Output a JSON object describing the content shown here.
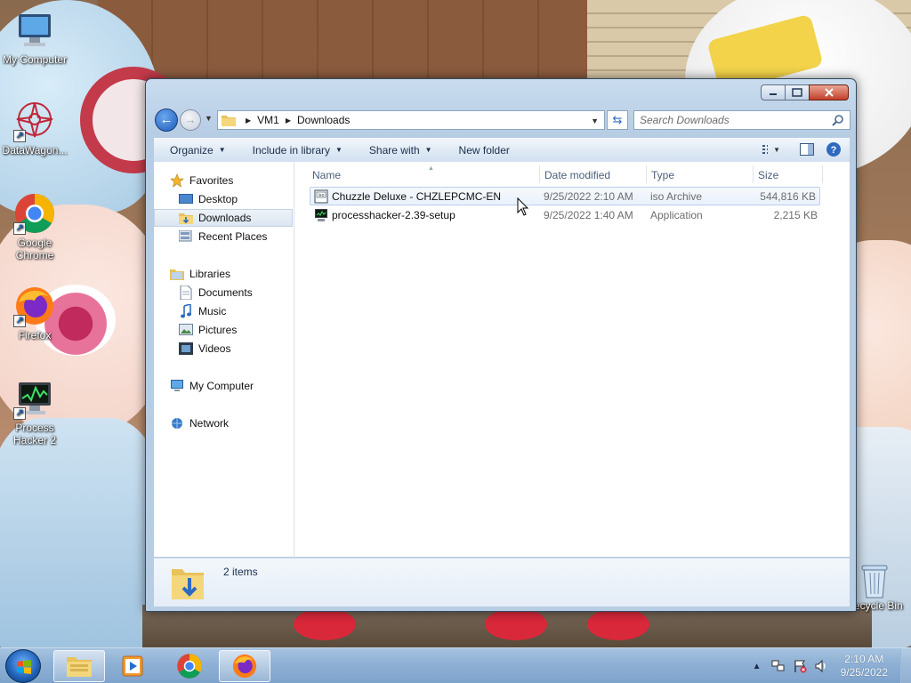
{
  "desktop": {
    "icons": [
      {
        "label": "My Computer",
        "icon": "computer-icon"
      },
      {
        "label": "DataWagon...",
        "icon": "datawagon-icon"
      },
      {
        "label": "Google Chrome",
        "icon": "chrome-icon"
      },
      {
        "label": "Firefox",
        "icon": "firefox-icon"
      },
      {
        "label": "Process Hacker 2",
        "icon": "process-hacker-icon"
      }
    ],
    "recycle_bin": "Recycle Bin"
  },
  "window": {
    "breadcrumb": [
      "VM1",
      "Downloads"
    ],
    "search_placeholder": "Search Downloads",
    "toolbar": {
      "organize": "Organize",
      "include_in_library": "Include in library",
      "share_with": "Share with",
      "new_folder": "New folder"
    },
    "nav": {
      "favorites": "Favorites",
      "desktop": "Desktop",
      "downloads": "Downloads",
      "recent_places": "Recent Places",
      "libraries": "Libraries",
      "documents": "Documents",
      "music": "Music",
      "pictures": "Pictures",
      "videos": "Videos",
      "my_computer": "My Computer",
      "network": "Network"
    },
    "columns": {
      "name": "Name",
      "date": "Date modified",
      "type": "Type",
      "size": "Size"
    },
    "files": [
      {
        "name": "Chuzzle Deluxe - CHZLEPCMC-EN",
        "date": "9/25/2022 2:10 AM",
        "type": "iso Archive",
        "size": "544,816 KB",
        "icon": "iso-icon"
      },
      {
        "name": "processhacker-2.39-setup",
        "date": "9/25/2022 1:40 AM",
        "type": "Application",
        "size": "2,215 KB",
        "icon": "application-icon"
      }
    ],
    "status": "2 items"
  },
  "taskbar": {
    "clock_time": "2:10 AM",
    "clock_date": "9/25/2022",
    "apps": [
      "file-explorer",
      "media-player",
      "chrome",
      "firefox"
    ]
  },
  "colors": {
    "accent": "#1c5bb8",
    "taskbar": "#8eb0d4",
    "close_button": "#c2402b"
  }
}
